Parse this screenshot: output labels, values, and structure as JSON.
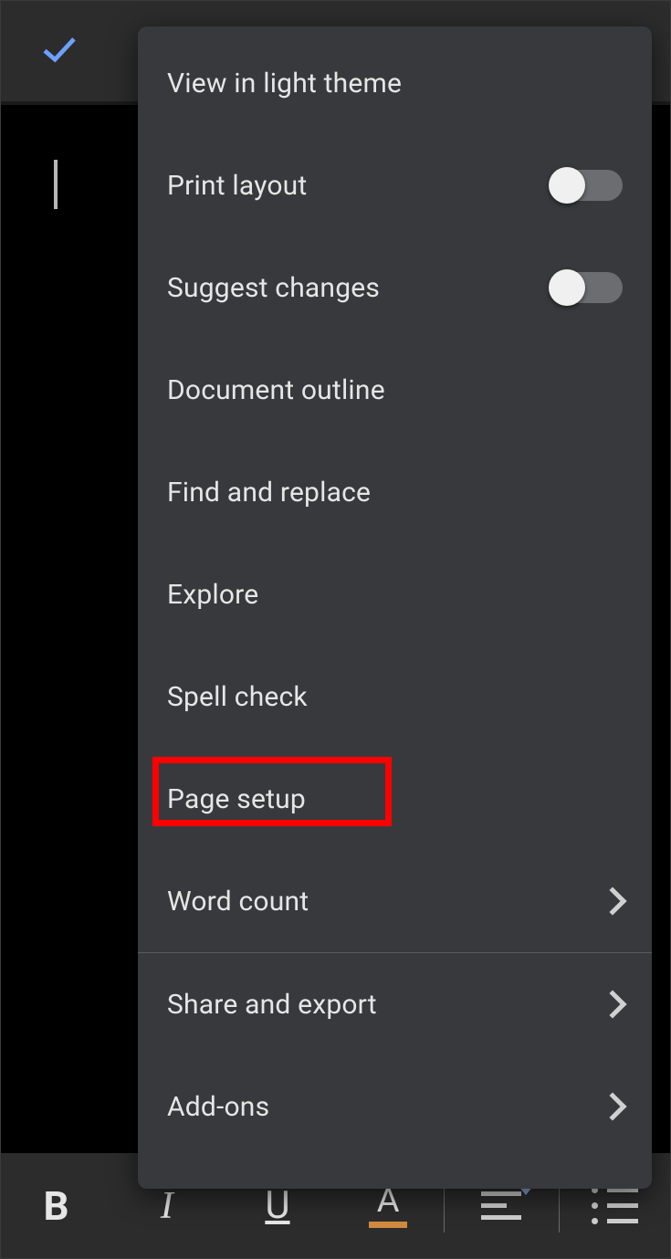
{
  "menu": {
    "items": [
      {
        "label": "View in light theme",
        "toggle": false,
        "submenu": false
      },
      {
        "label": "Print layout",
        "toggle": true,
        "submenu": false
      },
      {
        "label": "Suggest changes",
        "toggle": true,
        "submenu": false
      },
      {
        "label": "Document outline",
        "toggle": false,
        "submenu": false
      },
      {
        "label": "Find and replace",
        "toggle": false,
        "submenu": false
      },
      {
        "label": "Explore",
        "toggle": false,
        "submenu": false
      },
      {
        "label": "Spell check",
        "toggle": false,
        "submenu": false
      },
      {
        "label": "Page setup",
        "toggle": false,
        "submenu": false
      },
      {
        "label": "Word count",
        "toggle": false,
        "submenu": true
      },
      {
        "label": "Share and export",
        "toggle": false,
        "submenu": true
      },
      {
        "label": "Add-ons",
        "toggle": false,
        "submenu": true
      }
    ]
  },
  "toolbar": {
    "bold": "B",
    "italic": "I",
    "underline": "U",
    "textcolor": "A"
  },
  "highlighted_item_index": 7
}
